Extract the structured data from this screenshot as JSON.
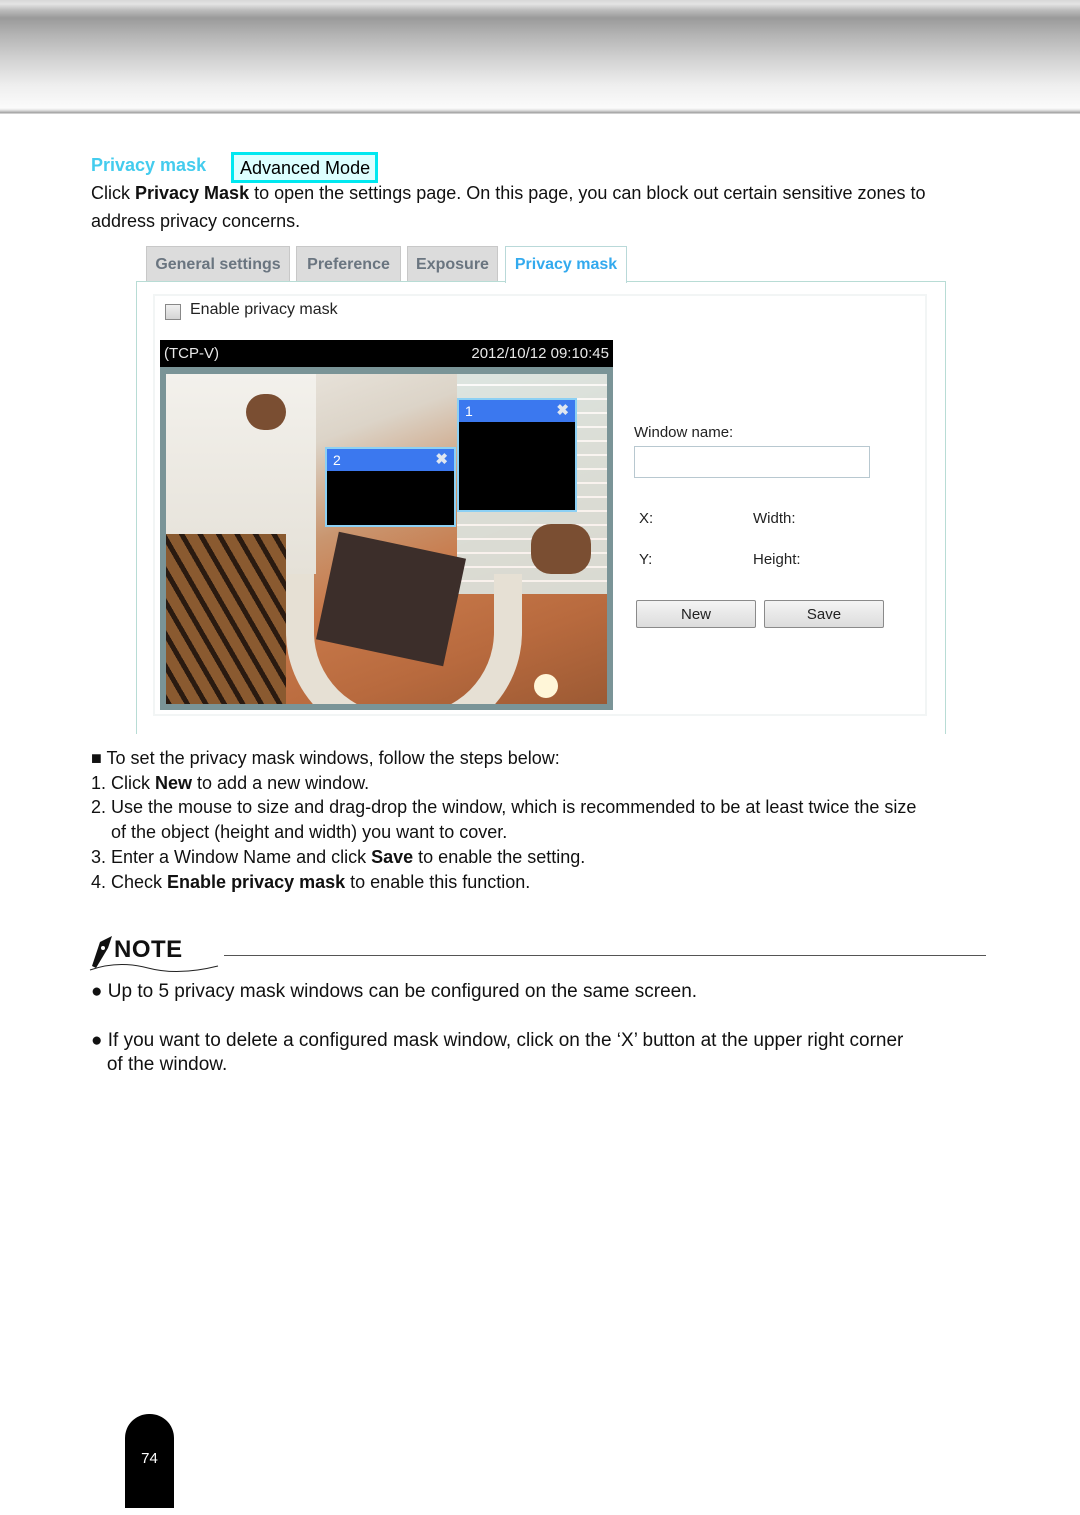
{
  "section": {
    "title": "Privacy mask",
    "mode_badge": "Advanced Mode",
    "intro_prefix": "Click ",
    "intro_bold": "Privacy Mask",
    "intro_suffix": " to open the settings page. On this page, you can block out certain sensitive zones to",
    "intro_line2": "address privacy concerns."
  },
  "screenshot": {
    "tabs": [
      {
        "label": "General settings",
        "active": false
      },
      {
        "label": "Preference",
        "active": false
      },
      {
        "label": "Exposure",
        "active": false
      },
      {
        "label": "Privacy mask",
        "active": true
      }
    ],
    "enable_checkbox": {
      "label": "Enable privacy mask",
      "checked": false
    },
    "viewer": {
      "source": "(TCP-V)",
      "timestamp": "2012/10/12 09:10:45",
      "masks": [
        {
          "id": "1",
          "close": "✖"
        },
        {
          "id": "2",
          "close": "✖"
        }
      ]
    },
    "form": {
      "window_name_label": "Window name:",
      "window_name_value": "",
      "x_label": "X:",
      "width_label": "Width:",
      "y_label": "Y:",
      "height_label": "Height:",
      "new_button": "New",
      "save_button": "Save"
    }
  },
  "steps": {
    "intro": "■ To set the privacy mask windows, follow the steps below:",
    "items": [
      {
        "prefix": "1. Click ",
        "bold": "New",
        "suffix": " to add a new window."
      },
      {
        "prefix": "2. Use the mouse to size and drag-drop the window, which is recommended to be at least twice the size",
        "bold": "",
        "suffix": ""
      },
      {
        "prefix": "    of the object (height and width) you want to cover.",
        "bold": "",
        "suffix": ""
      },
      {
        "prefix": "3. Enter a Window Name and click ",
        "bold": "Save",
        "suffix": " to enable the setting."
      },
      {
        "prefix": "4. Check ",
        "bold": "Enable privacy mask",
        "suffix": " to enable this function."
      }
    ]
  },
  "note": {
    "heading": "NOTE",
    "bullets": [
      "● Up to 5 privacy mask windows can be configured on the same screen.",
      "● If you want to delete a configured mask window, click on the ‘X’ button at the upper right corner",
      "   of the window."
    ]
  },
  "page_number": "74"
}
